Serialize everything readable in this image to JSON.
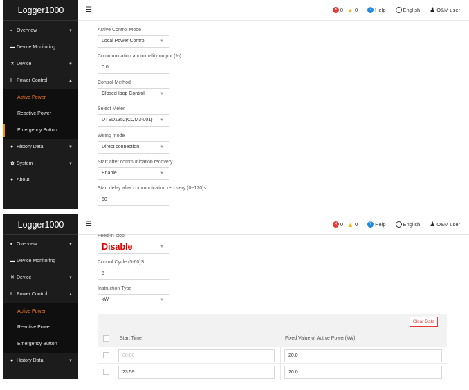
{
  "app": {
    "title": "Logger1000"
  },
  "topbar": {
    "errors": "0",
    "warnings": "0",
    "help": "Help",
    "language": "English",
    "user": "O&M user"
  },
  "sidebar": {
    "items": [
      {
        "label": "Overview",
        "icon": "grid-icon"
      },
      {
        "label": "Device Monitoring",
        "icon": "monitor-icon"
      },
      {
        "label": "Device",
        "icon": "tools-icon"
      },
      {
        "label": "Power Control",
        "icon": "power-control-icon"
      },
      {
        "label": "History Data",
        "icon": "clock-icon"
      },
      {
        "label": "System",
        "icon": "gear-icon"
      },
      {
        "label": "About",
        "icon": "info-icon"
      }
    ],
    "sub_items": [
      {
        "label": "Active Power"
      },
      {
        "label": "Reactive Power"
      },
      {
        "label": "Emergency Button"
      }
    ]
  },
  "form_top": {
    "active_control_mode": {
      "label": "Active Control Mode",
      "value": "Local Power Control"
    },
    "comm_abnormality_output": {
      "label": "Communication abnormality output (%)",
      "value": "0.0"
    },
    "control_method": {
      "label": "Control Method",
      "value": "Closed-loop Control"
    },
    "select_meter": {
      "label": "Select Meter",
      "value": "DTSD1352(COM3-001)"
    },
    "wiring_mode": {
      "label": "Wiring mode",
      "value": "Direct connection"
    },
    "start_after_recovery": {
      "label": "Start after communication recovery",
      "value": "Enable"
    },
    "start_delay": {
      "label": "Start delay after communication recovery (0~120)s",
      "value": "60"
    }
  },
  "form_bottom": {
    "feed_in_stop": {
      "label": "Feed-in stop",
      "value": "Disable"
    },
    "control_cycle": {
      "label": "Control Cycle (5-60)S",
      "value": "5"
    },
    "instruction_type": {
      "label": "Instruction Type",
      "value": "kW"
    }
  },
  "table": {
    "clear_label": "Clear Data",
    "columns": [
      "Start Time",
      "Fixed Value of Active Power(kW)"
    ],
    "rows": [
      {
        "start_time": "00:00",
        "value": "20.0"
      },
      {
        "start_time": "23:59",
        "value": "20.0"
      }
    ]
  }
}
